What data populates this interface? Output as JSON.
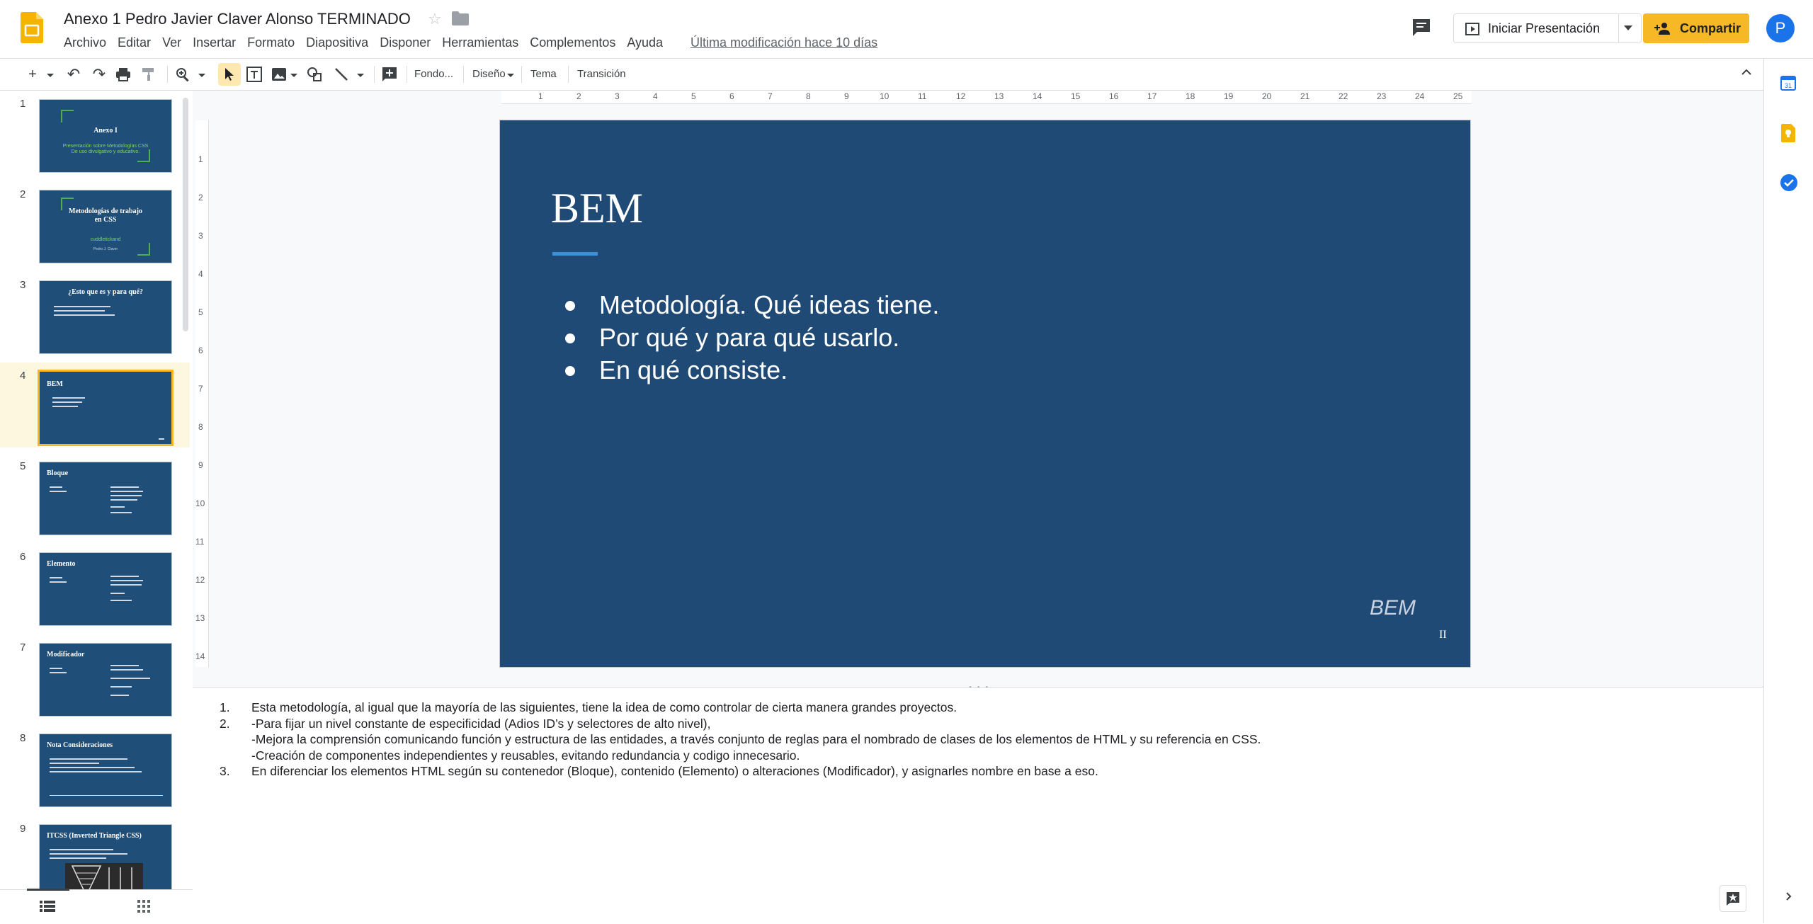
{
  "header": {
    "title": "Anexo 1 Pedro Javier Claver Alonso TERMINADO",
    "menu": [
      "Archivo",
      "Editar",
      "Ver",
      "Insertar",
      "Formato",
      "Diapositiva",
      "Disponer",
      "Herramientas",
      "Complementos",
      "Ayuda"
    ],
    "last_modified": "Última modificación hace 10 días",
    "present_label": "Iniciar Presentación",
    "share_label": "Compartir",
    "avatar_letter": "P"
  },
  "toolbar": {
    "background_label": "Fondo...",
    "layout_label": "Diseño",
    "theme_label": "Tema",
    "transition_label": "Transición"
  },
  "filmstrip": {
    "slides": [
      {
        "number": "1",
        "title": "Anexo I",
        "subtitle": "Presentación sobre Metodologías CSS De uso divulgativo y educativo."
      },
      {
        "number": "2",
        "title": "Metodologías de trabajo en CSS",
        "subtitle": "cuddletickand",
        "author": "Pedro J. Claver"
      },
      {
        "number": "3",
        "title": "¿Esto que es y para qué?"
      },
      {
        "number": "4",
        "title": "BEM"
      },
      {
        "number": "5",
        "title": "Bloque"
      },
      {
        "number": "6",
        "title": "Elemento"
      },
      {
        "number": "7",
        "title": "Modificador"
      },
      {
        "number": "8",
        "title": "Nota Consideraciones"
      },
      {
        "number": "9",
        "title": "ITCSS (Inverted Triangle CSS)"
      }
    ],
    "selected_index": 4
  },
  "ruler": {
    "top": [
      "1",
      "2",
      "3",
      "4",
      "5",
      "6",
      "7",
      "8",
      "9",
      "10",
      "11",
      "12",
      "13",
      "14",
      "15",
      "16",
      "17",
      "18",
      "19",
      "20",
      "21",
      "22",
      "23",
      "24",
      "25"
    ],
    "left": [
      "1",
      "2",
      "3",
      "4",
      "5",
      "6",
      "7",
      "8",
      "9",
      "10",
      "11",
      "12",
      "13",
      "14"
    ]
  },
  "slide": {
    "title": "BEM",
    "bullets": [
      "Metodología. Qué ideas tiene.",
      "Por qué y para qué usarlo.",
      "En qué consiste."
    ],
    "footer_text": "BEM",
    "page_number": "II"
  },
  "notes": {
    "items": [
      {
        "num": "1.",
        "lines": [
          "Esta metodología, al igual que la mayoría de las siguientes, tiene la idea de como controlar de cierta manera grandes proyectos."
        ]
      },
      {
        "num": "2.",
        "lines": [
          "-Para fijar un nivel constante de especificidad (Adios ID’s y selectores de alto nivel),",
          "-Mejora la comprensión comunicando función y estructura de las entidades, a través conjunto de reglas para el nombrado de clases de los elementos de HTML y su referencia en CSS.",
          "-Creación de componentes independientes y reusables, evitando redundancia y codigo innecesario."
        ]
      },
      {
        "num": "3.",
        "lines": [
          "En diferenciar los elementos HTML según su contenedor (Bloque), contenido (Elemento) o alteraciones (Modificador), y asignarles nombre en base a eso."
        ]
      }
    ]
  },
  "colors": {
    "slide_background": "#1f4a75",
    "accent": "#3d8fd8",
    "share_button": "#f6b824",
    "app_logo": "#f4b400",
    "avatar": "#1a73e8"
  }
}
